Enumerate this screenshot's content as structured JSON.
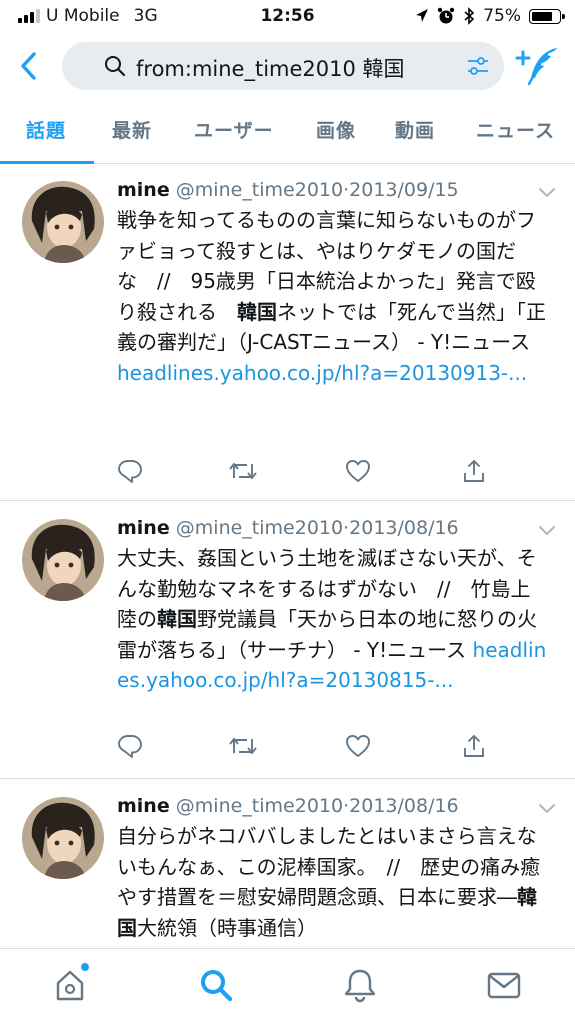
{
  "status_bar": {
    "carrier": "U Mobile",
    "network": "3G",
    "time": "12:56",
    "battery": "75%",
    "battery_level": 0.75
  },
  "search": {
    "query": "from:mine_time2010 韓国"
  },
  "tabs": [
    {
      "label": "話題",
      "active": true
    },
    {
      "label": "最新",
      "active": false
    },
    {
      "label": "ユーザー",
      "active": false
    },
    {
      "label": "画像",
      "active": false
    },
    {
      "label": "動画",
      "active": false
    },
    {
      "label": "ニュース",
      "active": false
    }
  ],
  "tweets": [
    {
      "name": "mine",
      "handle": "@mine_time2010",
      "sep": "·",
      "date": "2013/09/15",
      "text_a": "戦争を知ってるものの言葉に知らないものがファビョって殺すとは、やはりケダモノの国だな　//　95歳男「日本統治よかった」発言で殴り殺される　",
      "keyword": "韓国",
      "text_b": "ネットでは「死んで当然」「正義の審判だ」（J-CASTニュース） - Y!ニュース ",
      "link": "headlines.yahoo.co.jp/hl?a=20130913-..."
    },
    {
      "name": "mine",
      "handle": "@mine_time2010",
      "sep": "·",
      "date": "2013/08/16",
      "text_a": "大丈夫、姦国という土地を滅ぼさない天が、そんな勤勉なマネをするはずがない　//　竹島上陸の",
      "keyword": "韓国",
      "text_b": "野党議員「天から日本の地に怒りの火雷が落ちる」（サーチナ） - Y!ニュース ",
      "link": "headlines.yahoo.co.jp/hl?a=20130815-..."
    },
    {
      "name": "mine",
      "handle": "@mine_time2010",
      "sep": "·",
      "date": "2013/08/16",
      "text_a": "自分らがネコババしましたとはいまさら言えないもんなぁ、この泥棒国家。　//　歴史の痛み癒やす措置を＝慰安婦問題念頭、日本に要求―",
      "keyword": "韓国",
      "text_b": "大統領（時事通信）",
      "link": ""
    }
  ],
  "icons": {
    "back": "chevron-left-icon",
    "search": "search-icon",
    "filter": "filter-icon",
    "compose": "compose-tweet-icon",
    "reply": "reply-icon",
    "retweet": "retweet-icon",
    "like": "like-icon",
    "share": "share-icon",
    "home": "home-icon",
    "explore": "search-icon",
    "notifications": "bell-icon",
    "messages": "mail-icon"
  },
  "colors": {
    "accent": "#1da1f2",
    "link": "#1b95e0",
    "muted": "#657786"
  }
}
